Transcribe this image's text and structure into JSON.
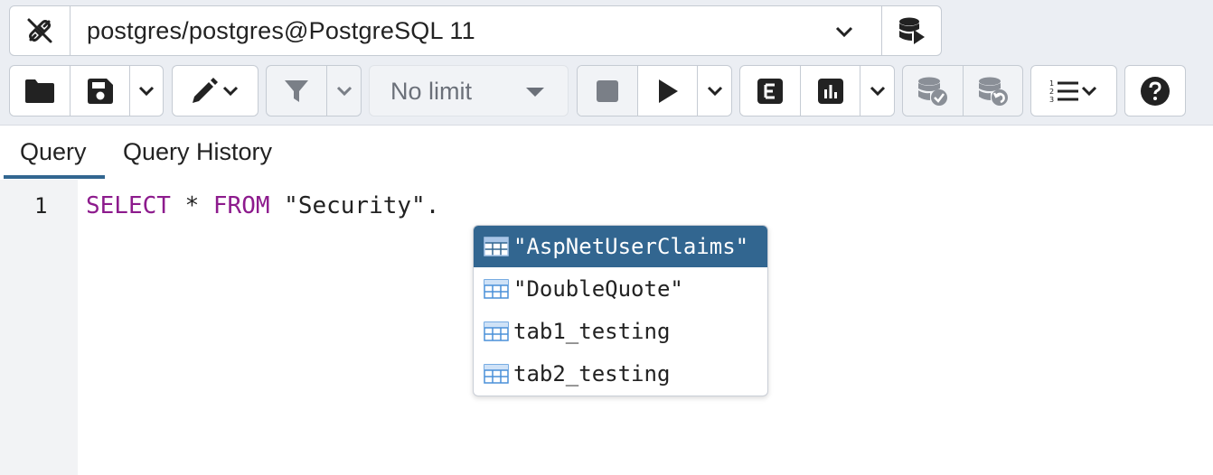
{
  "connection": {
    "label": "postgres/postgres@PostgreSQL 11"
  },
  "toolbar": {
    "row_limit": "No limit"
  },
  "tabs": [
    {
      "label": "Query"
    },
    {
      "label": "Query History"
    }
  ],
  "editor": {
    "line_number": "1",
    "tokens": [
      "SELECT",
      " * ",
      "FROM",
      " \"Security\"."
    ]
  },
  "autocomplete": {
    "items": [
      {
        "label": "\"AspNetUserClaims\""
      },
      {
        "label": "\"DoubleQuote\""
      },
      {
        "label": "tab1_testing"
      },
      {
        "label": "tab2_testing"
      }
    ]
  },
  "colors": {
    "accent": "#326690",
    "keyword": "#8d1b8d",
    "background": "#ebeef3"
  }
}
